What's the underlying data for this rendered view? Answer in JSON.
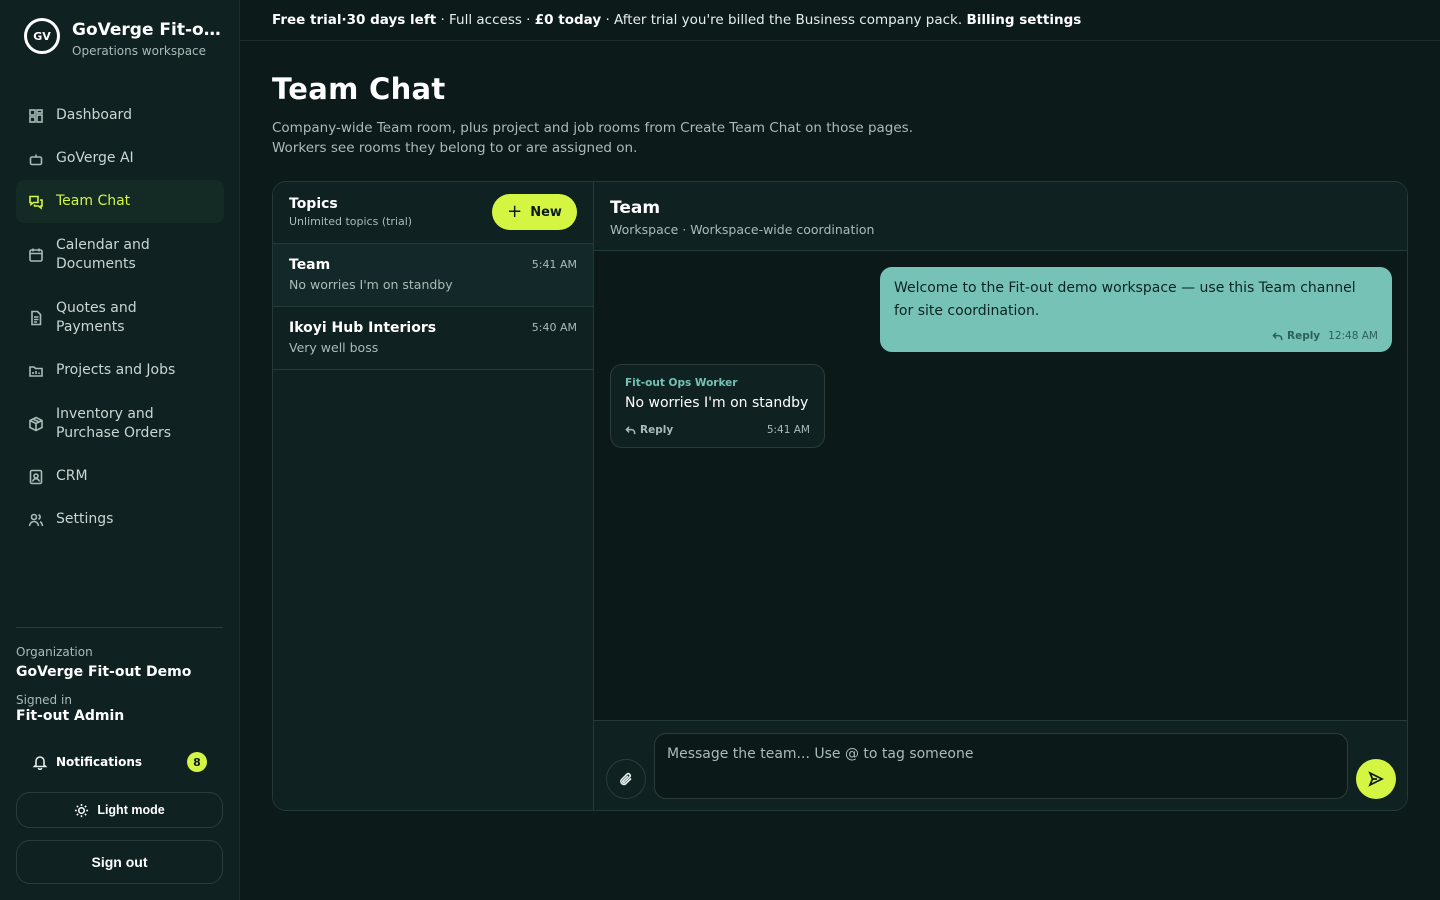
{
  "brand": {
    "logo_text": "GV",
    "title": "GoVerge Fit-out Demo",
    "subtitle": "Operations workspace"
  },
  "nav": [
    {
      "label": "Dashboard",
      "icon": "grid-icon",
      "active": false
    },
    {
      "label": "GoVerge AI",
      "icon": "robot-icon",
      "active": false
    },
    {
      "label": "Team Chat",
      "icon": "chat-icon",
      "active": true
    },
    {
      "label": "Calendar and Documents",
      "icon": "calendar-icon",
      "active": false
    },
    {
      "label": "Quotes and Payments",
      "icon": "document-icon",
      "active": false
    },
    {
      "label": "Projects and Jobs",
      "icon": "folder-icon",
      "active": false
    },
    {
      "label": "Inventory and Purchase Orders",
      "icon": "box-icon",
      "active": false
    },
    {
      "label": "CRM",
      "icon": "contact-icon",
      "active": false
    },
    {
      "label": "Settings",
      "icon": "users-icon",
      "active": false
    }
  ],
  "sidebar_bottom": {
    "org_label": "Organization",
    "org_name": "GoVerge Fit-out Demo",
    "signed_label": "Signed in",
    "signed_name": "Fit-out Admin",
    "notifications_label": "Notifications",
    "notifications_count": "8",
    "light_mode_label": "Light mode",
    "sign_out_label": "Sign out"
  },
  "banner": {
    "trial": "Free trial",
    "sep1": " · ",
    "days": "30 days left",
    "access": " · Full access · ",
    "price": "£0 today",
    "billing_note": " · After trial you're billed the Business company pack. ",
    "link": "Billing settings"
  },
  "page": {
    "title": "Team Chat",
    "desc_line1": "Company-wide Team room, plus project and job rooms from Create Team Chat on those pages.",
    "desc_line2": "Workers see rooms they belong to or are assigned on."
  },
  "topics": {
    "title": "Topics",
    "subtitle": "Unlimited topics (trial)",
    "new_label": "New",
    "items": [
      {
        "name": "Team",
        "preview": "No worries I'm on standby",
        "time": "5:41 AM"
      },
      {
        "name": "Ikoyi Hub Interiors",
        "preview": "Very well boss",
        "time": "5:40 AM"
      }
    ]
  },
  "chat": {
    "title": "Team",
    "subtitle": "Workspace · Workspace-wide coordination",
    "messages": [
      {
        "direction": "out",
        "text": "Welcome to the Fit-out demo workspace — use this Team channel for site coordination.",
        "reply": "Reply",
        "time": "12:48 AM"
      },
      {
        "direction": "in",
        "sender": "Fit-out Ops Worker",
        "text": "No worries I'm on standby",
        "reply": "Reply",
        "time": "5:41 AM"
      }
    ],
    "input_placeholder": "Message the team... Use @ to tag someone"
  },
  "colors": {
    "accent": "#d4f542",
    "bubble_out": "#76c2b6",
    "background": "#0c1a1a"
  }
}
